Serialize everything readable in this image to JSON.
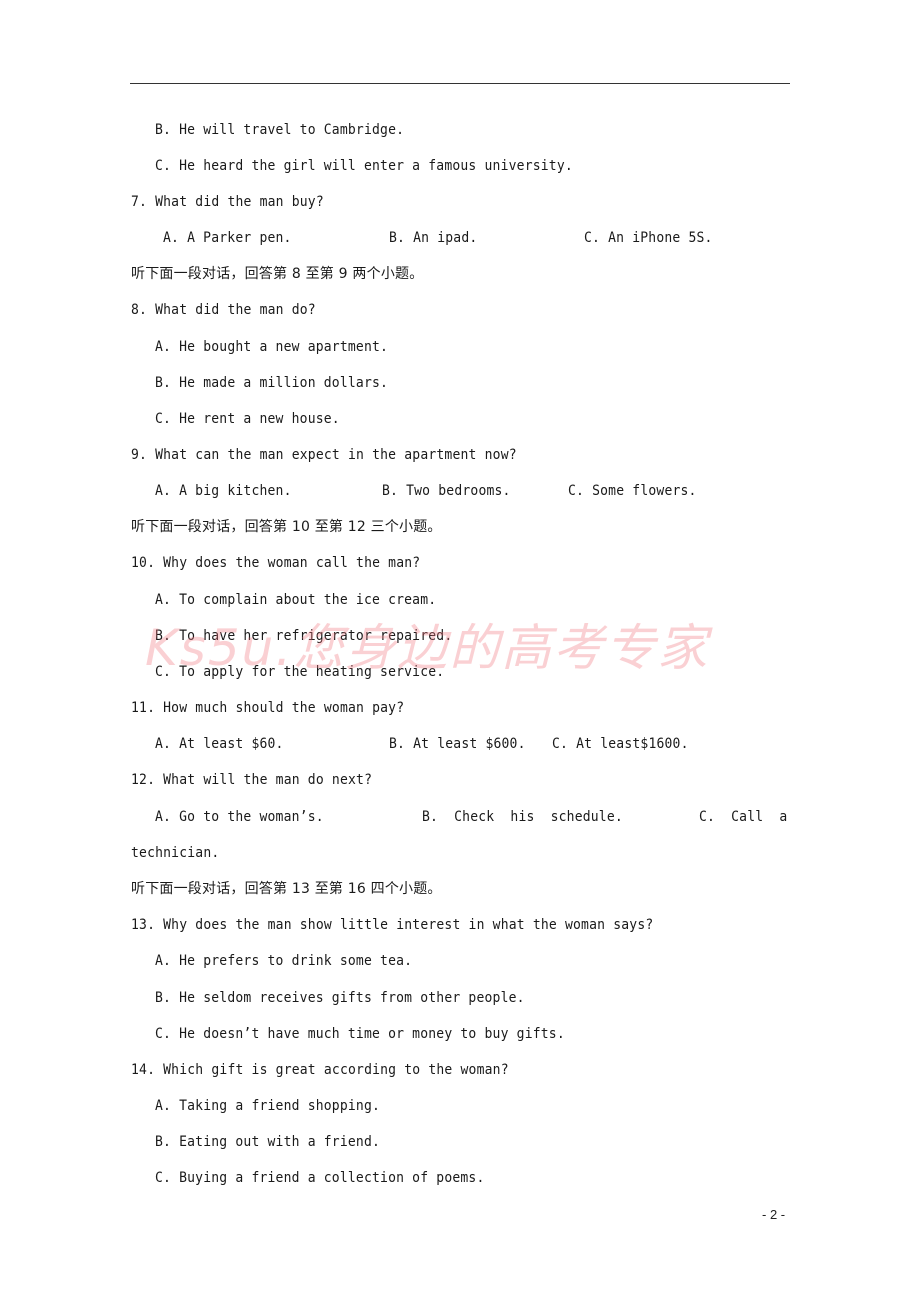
{
  "page": {
    "page_number": "- 2 -",
    "watermark": "Ks5u.您身边的高考专家"
  },
  "lines": {
    "q6b": "B. He will travel to Cambridge.",
    "q6c": "C. He heard the girl will enter a famous university.",
    "q7": "7. What did the man buy?",
    "q7a": "A. A Parker pen.",
    "q7b": "B. An ipad.",
    "q7c": "C. An iPhone 5S.",
    "sec89": "听下面一段对话，回答第 8 至第 9 两个小题。",
    "q8": "8. What did the man do?",
    "q8a": "A. He bought a new apartment.",
    "q8b": "B. He made a million dollars.",
    "q8c": "C. He rent a new house.",
    "q9": "9. What can the man expect in the apartment now?",
    "q9a": "A. A big kitchen.",
    "q9b": "B. Two bedrooms.",
    "q9c": "C. Some flowers.",
    "sec1012": "听下面一段对话，回答第 10 至第 12 三个小题。",
    "q10": "10. Why does the woman call the man?",
    "q10a": "A. To complain about the ice cream.",
    "q10b": "B. To have her refrigerator repaired.",
    "q10c": "C. To apply for the heating service.",
    "q11": "11. How much should the woman pay?",
    "q11a": "A. At least $60.",
    "q11b": "B. At least $600.",
    "q11c": "C. At least$1600.",
    "q12": "12. What will the man do next?",
    "q12a": "A. Go to the woman’s.",
    "q12b": "B.  Check  his  schedule.",
    "q12c": "C.  Call  a",
    "q12c_cont": "technician.",
    "sec1316": "听下面一段对话，回答第 13 至第 16 四个小题。",
    "q13": "13. Why does the man show little interest in what the woman says?",
    "q13a": "A. He prefers to drink some tea.",
    "q13b": "B. He seldom receives gifts from other people.",
    "q13c": "C. He doesn’t have much time or money to buy gifts.",
    "q14": "14. Which gift is great according to the woman?",
    "q14a": "A. Taking a friend shopping.",
    "q14b": "B. Eating out with a friend.",
    "q14c": "C. Buying a friend a collection of poems."
  }
}
